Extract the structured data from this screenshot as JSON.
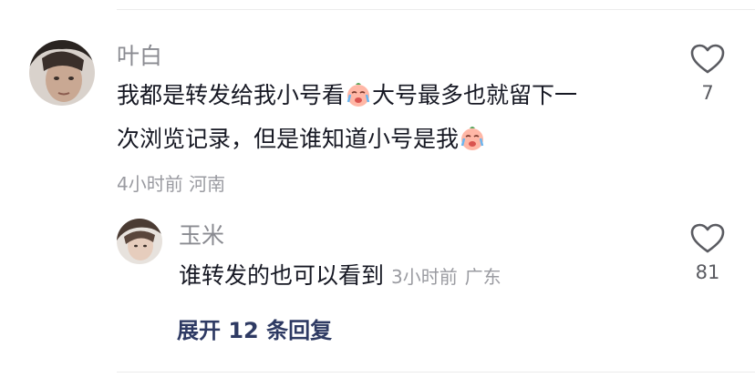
{
  "comment": {
    "username": "叶白",
    "text_line1": "我都是转发给我小号看",
    "text_line1b": "大号最多也就留下一",
    "text_line2": "次浏览记录，但是谁知道小号是我",
    "emoji_name": "crying-laughing-emoji",
    "time": "4小时前",
    "location": "河南",
    "like_count": "7"
  },
  "reply": {
    "username": "玉米",
    "text": "谁转发的也可以看到",
    "time": "3小时前",
    "location": "广东",
    "like_count": "81"
  },
  "expand_label": "展开 12 条回复",
  "icons": {
    "like": "heart-outline-icon",
    "emoji": "crying-laughing-emoji"
  },
  "colors": {
    "username": "#8a8b91",
    "expand": "#2e3a63",
    "meta": "#9a9ba1"
  }
}
